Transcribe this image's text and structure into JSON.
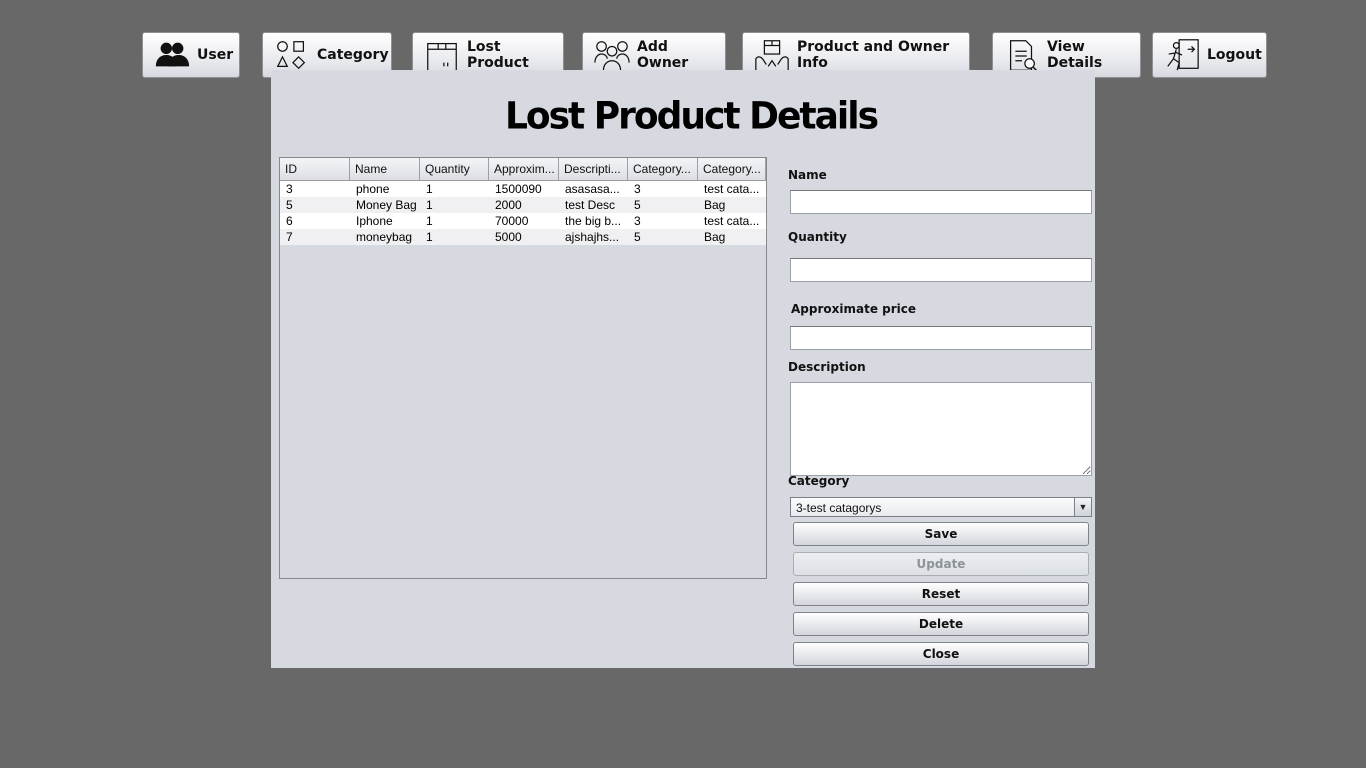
{
  "nav": {
    "user": {
      "label": "User",
      "icon": "users-icon"
    },
    "category": {
      "label": "Category",
      "icon": "shapes-icon"
    },
    "lost_product": {
      "label": "Lost Product",
      "icon": "box-icon"
    },
    "add_owner": {
      "label": "Add Owner",
      "icon": "people-group-icon"
    },
    "product_owner_info": {
      "label": "Product and Owner Info",
      "icon": "hand-box-icon"
    },
    "view_details": {
      "label": "View Details",
      "icon": "document-search-icon"
    },
    "logout": {
      "label": "Logout",
      "icon": "exit-icon"
    }
  },
  "page": {
    "title": "Lost Product Details"
  },
  "table": {
    "columns": [
      "ID",
      "Name",
      "Quantity",
      "Approxim...",
      "Descripti...",
      "Category...",
      "Category..."
    ],
    "rows": [
      [
        "3",
        "phone",
        "1",
        "1500090",
        "asasasa...",
        "3",
        "test cata..."
      ],
      [
        "5",
        "Money Bag",
        "1",
        "2000",
        "test Desc",
        "5",
        "Bag"
      ],
      [
        "6",
        "Iphone",
        "1",
        "70000",
        "the big b...",
        "3",
        "test cata..."
      ],
      [
        "7",
        "moneybag",
        "1",
        "5000",
        "ajshajhs...",
        "5",
        "Bag"
      ]
    ]
  },
  "form": {
    "name_label": "Name",
    "name_value": "",
    "quantity_label": "Quantity",
    "quantity_value": "",
    "price_label": "Approximate price",
    "price_value": "",
    "description_label": "Description",
    "description_value": "",
    "category_label": "Category",
    "category_selected": "3-test catagorys"
  },
  "buttons": {
    "save": "Save",
    "update": "Update",
    "reset": "Reset",
    "delete": "Delete",
    "close": "Close"
  },
  "colors": {
    "background": "#686868",
    "panel": "#d6d9e0",
    "disabled_text": "#8e9299"
  }
}
